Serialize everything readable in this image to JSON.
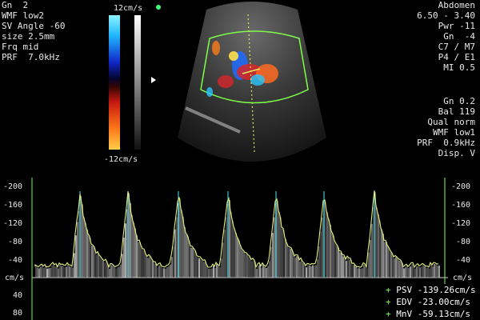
{
  "top_left": {
    "lines": [
      "Gn  2",
      "WMF low2",
      "SV Angle -60",
      "size 2.5mm",
      "Frq mid",
      "PRF  7.0kHz"
    ]
  },
  "top_right": {
    "lines": [
      "Abdomen",
      "6.50 - 3.40",
      "Pwr -11",
      "Gn  -4",
      "C7 / M7",
      "P4 / E1",
      "MI 0.5"
    ]
  },
  "mid_right": {
    "lines": [
      "Gn 0.2",
      "Bal 119",
      "Qual norm",
      "WMF low1",
      "PRF  0.9kHz",
      "Disp. V"
    ]
  },
  "color_scale": {
    "top_label": "12cm/s",
    "bottom_label": "-12cm/s"
  },
  "waveform": {
    "left_axis": [
      "-200",
      "-160",
      "-120",
      "-80",
      "-40",
      "cm/s",
      "40",
      "80"
    ],
    "right_axis": [
      "-200",
      "-160",
      "-120",
      "-80",
      "-40",
      "cm/s",
      "40",
      "80"
    ]
  },
  "measurements": {
    "psv": "PSV -139.26cm/s",
    "edv": "EDV -23.00cm/s",
    "mnv": "MnV -59.13cm/s"
  },
  "colors": {
    "trace": "#e6f07a",
    "cursor": "#dfe85a",
    "box": "#7dff4a",
    "marker_line": "#3ec3d6"
  }
}
